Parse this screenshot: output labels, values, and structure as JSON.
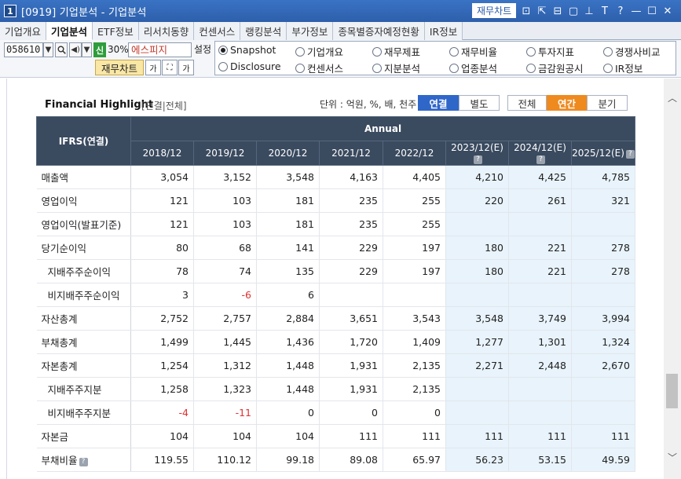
{
  "window": {
    "number": "1",
    "title": "[0919] 기업분석 - 기업분석",
    "chart_button": "재무차트",
    "icons": [
      "chart-icon",
      "link-icon",
      "popup-icon",
      "restore-icon",
      "pin-icon",
      "font-icon",
      "help-icon",
      "minimize-icon",
      "maximize-icon",
      "close-icon"
    ],
    "icon_glyphs": [
      "⊡",
      "⇱",
      "⊟",
      "▢",
      "⊥",
      "T",
      "?",
      "—",
      "☐",
      "✕"
    ]
  },
  "tabs": [
    {
      "label": "기업개요",
      "active": false
    },
    {
      "label": "기업분석",
      "active": true
    },
    {
      "label": "ETF정보",
      "active": false
    },
    {
      "label": "리서치동향",
      "active": false
    },
    {
      "label": "컨센서스",
      "active": false
    },
    {
      "label": "랭킹분석",
      "active": false
    },
    {
      "label": "부가정보",
      "active": false
    },
    {
      "label": "종목별증자예정현황",
      "active": false
    },
    {
      "label": "IR정보",
      "active": false
    }
  ],
  "toolbar": {
    "stock_code": "058610",
    "new_badge": "신",
    "margin_pct": "30%",
    "stock_name": "에스피지",
    "setting_label": "설정",
    "fin_chart_label": "재무차트",
    "btn_ga": "가",
    "btn_gaplus": "가"
  },
  "radios": [
    {
      "label": "Snapshot",
      "selected": true
    },
    {
      "label": "기업개요",
      "selected": false
    },
    {
      "label": "재무제표",
      "selected": false
    },
    {
      "label": "재무비율",
      "selected": false
    },
    {
      "label": "투자지표",
      "selected": false
    },
    {
      "label": "경쟁사비교",
      "selected": false
    },
    {
      "label": "Disclosure",
      "selected": false
    },
    {
      "label": "컨센서스",
      "selected": false
    },
    {
      "label": "지분분석",
      "selected": false
    },
    {
      "label": "업종분석",
      "selected": false
    },
    {
      "label": "금감원공시",
      "selected": false
    },
    {
      "label": "IR정보",
      "selected": false
    }
  ],
  "highlight": {
    "title": "Financial Highlight",
    "subtitle": "[연결|전체]",
    "unit": "단위 : 억원, %, 배, 천주",
    "seg_consolidated": "연결",
    "seg_separate": "별도",
    "seg_all": "전체",
    "seg_annual": "연간",
    "seg_quarter": "분기"
  },
  "table": {
    "corner_header": "IFRS(연결)",
    "group_header": "Annual",
    "columns": [
      "2018/12",
      "2019/12",
      "2020/12",
      "2021/12",
      "2022/12",
      "2023/12(E)",
      "2024/12(E)",
      "2025/12(E)"
    ],
    "estimate_flags": [
      false,
      false,
      false,
      false,
      false,
      true,
      true,
      true
    ],
    "rows": [
      {
        "label": "매출액",
        "sub": false,
        "help": false,
        "values": [
          "3,054",
          "3,152",
          "3,548",
          "4,163",
          "4,405",
          "4,210",
          "4,425",
          "4,785"
        ]
      },
      {
        "label": "영업이익",
        "sub": false,
        "help": false,
        "values": [
          "121",
          "103",
          "181",
          "235",
          "255",
          "220",
          "261",
          "321"
        ]
      },
      {
        "label": "영업이익(발표기준)",
        "sub": false,
        "help": false,
        "values": [
          "121",
          "103",
          "181",
          "235",
          "255",
          "",
          "",
          ""
        ]
      },
      {
        "label": "당기순이익",
        "sub": false,
        "help": false,
        "values": [
          "80",
          "68",
          "141",
          "229",
          "197",
          "180",
          "221",
          "278"
        ]
      },
      {
        "label": "지배주주순이익",
        "sub": true,
        "help": false,
        "values": [
          "78",
          "74",
          "135",
          "229",
          "197",
          "180",
          "221",
          "278"
        ]
      },
      {
        "label": "비지배주주순이익",
        "sub": true,
        "help": false,
        "values": [
          "3",
          "-6",
          "6",
          "",
          "",
          "",
          "",
          ""
        ]
      },
      {
        "label": "자산총계",
        "sub": false,
        "help": false,
        "values": [
          "2,752",
          "2,757",
          "2,884",
          "3,651",
          "3,543",
          "3,548",
          "3,749",
          "3,994"
        ]
      },
      {
        "label": "부채총계",
        "sub": false,
        "help": false,
        "values": [
          "1,499",
          "1,445",
          "1,436",
          "1,720",
          "1,409",
          "1,277",
          "1,301",
          "1,324"
        ]
      },
      {
        "label": "자본총계",
        "sub": false,
        "help": false,
        "values": [
          "1,254",
          "1,312",
          "1,448",
          "1,931",
          "2,135",
          "2,271",
          "2,448",
          "2,670"
        ]
      },
      {
        "label": "지배주주지분",
        "sub": true,
        "help": false,
        "values": [
          "1,258",
          "1,323",
          "1,448",
          "1,931",
          "2,135",
          "",
          "",
          ""
        ]
      },
      {
        "label": "비지배주주지분",
        "sub": true,
        "help": false,
        "values": [
          "-4",
          "-11",
          "0",
          "0",
          "0",
          "",
          "",
          ""
        ]
      },
      {
        "label": "자본금",
        "sub": false,
        "help": false,
        "values": [
          "104",
          "104",
          "104",
          "111",
          "111",
          "111",
          "111",
          "111"
        ]
      },
      {
        "label": "부채비율",
        "sub": false,
        "help": true,
        "values": [
          "119.55",
          "110.12",
          "99.18",
          "89.08",
          "65.97",
          "56.23",
          "53.15",
          "49.59"
        ]
      }
    ]
  },
  "colors": {
    "titlebar": "#2d5fab",
    "header_bg": "#3a4a5f",
    "estimate_bg": "#e8f3fb",
    "negative": "#e03030",
    "accent_blue": "#2f67c9",
    "accent_orange": "#ef8a1f"
  }
}
